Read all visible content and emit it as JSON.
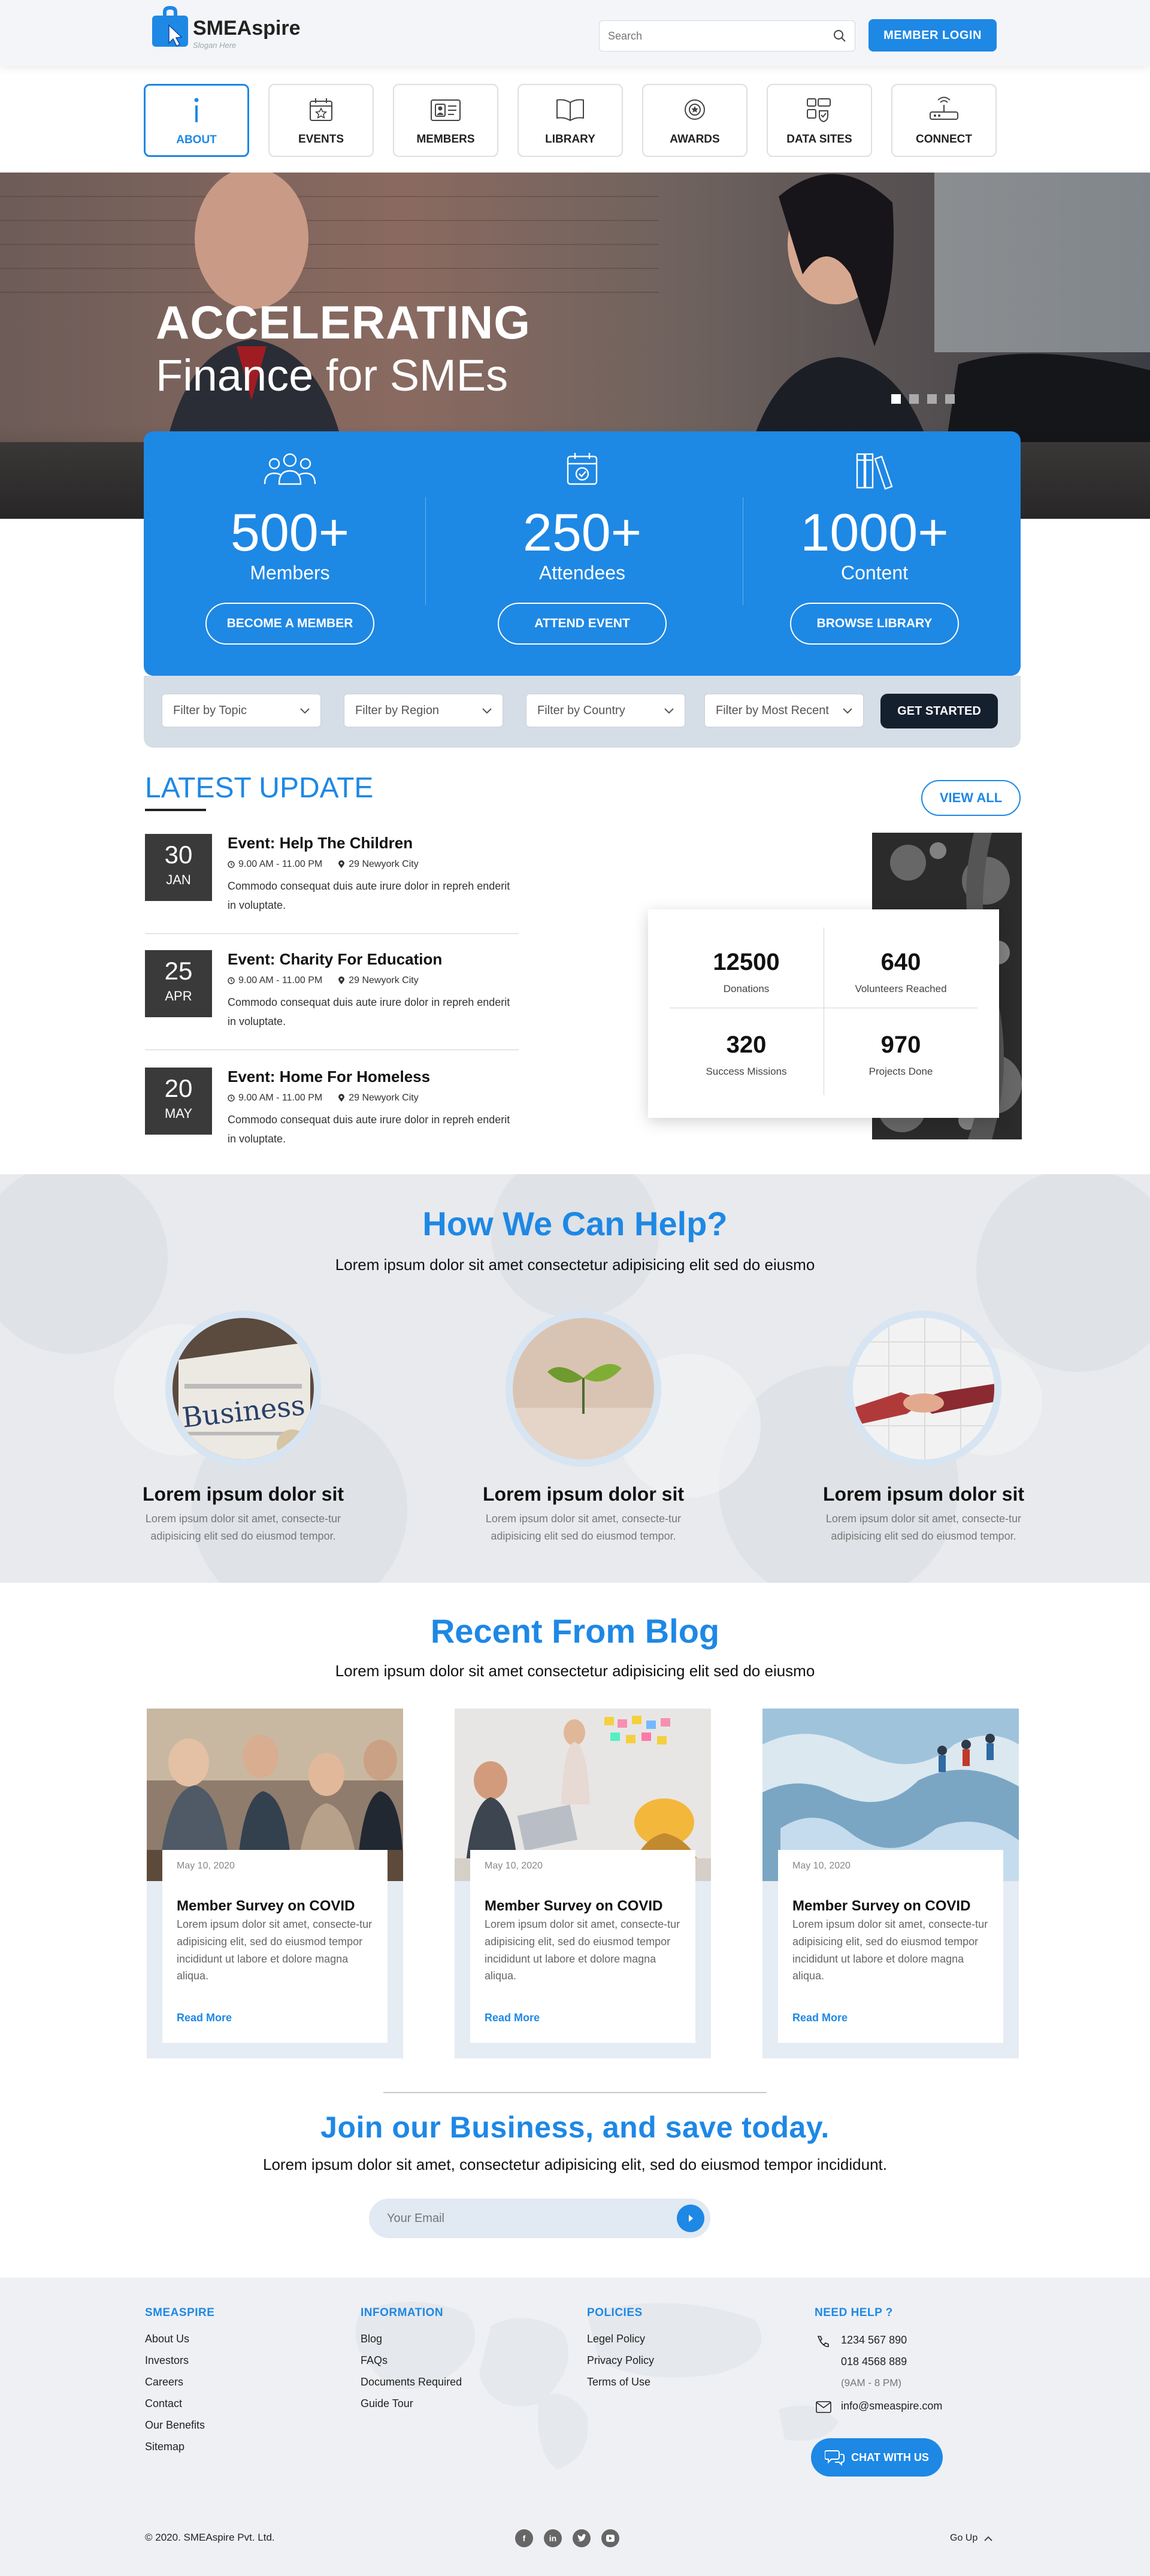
{
  "header": {
    "brand": "SMEAspire",
    "tagline": "Slogan Here",
    "search_placeholder": "Search",
    "login_label": "MEMBER LOGIN"
  },
  "nav": [
    {
      "label": "ABOUT",
      "icon": "info-icon",
      "active": true
    },
    {
      "label": "EVENTS",
      "icon": "calendar-star-icon"
    },
    {
      "label": "MEMBERS",
      "icon": "id-card-icon"
    },
    {
      "label": "LIBRARY",
      "icon": "book-icon"
    },
    {
      "label": "AWARDS",
      "icon": "medal-icon"
    },
    {
      "label": "DATA SITES",
      "icon": "data-sites-icon"
    },
    {
      "label": "CONNECT",
      "icon": "router-icon"
    }
  ],
  "hero": {
    "title": "ACCELERATING",
    "subtitle": "Finance for SMEs",
    "slides": 4,
    "active_slide": 1
  },
  "stats": [
    {
      "value": "500+",
      "label": "Members",
      "button": "BECOME A MEMBER",
      "icon": "people-icon"
    },
    {
      "value": "250+",
      "label": "Attendees",
      "button": "ATTEND EVENT",
      "icon": "calendar-check-icon"
    },
    {
      "value": "1000+",
      "label": "Content",
      "button": "BROWSE LIBRARY",
      "icon": "books-icon"
    }
  ],
  "filters": {
    "topic": "Filter by Topic",
    "region": "Filter by Region",
    "country": "Filter by Country",
    "recent": "Filter by Most Recent",
    "cta": "GET STARTED"
  },
  "latest": {
    "title": "LATEST UPDATE",
    "view_all": "VIEW ALL",
    "events": [
      {
        "day": "30",
        "month": "JAN",
        "title": "Event: Help The Children",
        "time": "9.00 AM - 11.00 PM",
        "place": "29 Newyork City",
        "desc": "Commodo consequat duis aute irure dolor in repreh enderit in voluptate."
      },
      {
        "day": "25",
        "month": "APR",
        "title": "Event: Charity For Education",
        "time": "9.00 AM - 11.00 PM",
        "place": "29 Newyork City",
        "desc": "Commodo consequat duis aute irure dolor in repreh enderit in voluptate."
      },
      {
        "day": "20",
        "month": "MAY",
        "title": "Event: Home For Homeless",
        "time": "9.00 AM - 11.00 PM",
        "place": "29 Newyork City",
        "desc": "Commodo consequat duis aute irure dolor in repreh enderit in voluptate."
      }
    ],
    "counters": [
      {
        "value": "12500",
        "label": "Donations"
      },
      {
        "value": "640",
        "label": "Volunteers Reached"
      },
      {
        "value": "320",
        "label": "Success Missions"
      },
      {
        "value": "970",
        "label": "Projects Done"
      }
    ]
  },
  "help": {
    "title": "How We Can Help?",
    "subtitle": "Lorem ipsum dolor sit amet consectetur adipisicing elit sed do eiusmo",
    "items": [
      {
        "title": "Lorem ipsum dolor sit",
        "desc": "Lorem ipsum dolor sit amet, consecte-tur adipisicing elit sed do eiusmod tempor.",
        "image": "newspaper-business"
      },
      {
        "title": "Lorem ipsum dolor sit",
        "desc": "Lorem ipsum dolor sit amet, consecte-tur adipisicing elit sed do eiusmod tempor.",
        "image": "seedling-sprout"
      },
      {
        "title": "Lorem ipsum dolor sit",
        "desc": "Lorem ipsum dolor sit amet, consecte-tur adipisicing elit sed do eiusmod tempor.",
        "image": "handshake"
      }
    ],
    "business_word": "Business"
  },
  "blog": {
    "title": "Recent From Blog",
    "subtitle": "Lorem ipsum dolor sit amet consectetur adipisicing elit sed do eiusmo",
    "posts": [
      {
        "date": "May 10, 2020",
        "title": "Member Survey on  COVID",
        "excerpt": "Lorem ipsum dolor sit amet, consecte-tur adipisicing elit, sed do eiusmod tempor incididunt ut labore et dolore magna aliqua.",
        "more": "Read More"
      },
      {
        "date": "May 10, 2020",
        "title": "Member Survey on  COVID",
        "excerpt": "Lorem ipsum dolor sit amet, consecte-tur adipisicing elit, sed do eiusmod tempor incididunt ut labore et dolore magna aliqua.",
        "more": "Read More"
      },
      {
        "date": "May 10, 2020",
        "title": "Member Survey on  COVID",
        "excerpt": "Lorem ipsum dolor sit amet, consecte-tur adipisicing elit, sed do eiusmod tempor incididunt ut labore et dolore magna aliqua.",
        "more": "Read More"
      }
    ]
  },
  "join": {
    "title": "Join our Business, and save today.",
    "subtitle": "Lorem ipsum dolor sit amet, consectetur adipisicing elit, sed do eiusmod tempor incididunt.",
    "placeholder": "Your Email"
  },
  "footer": {
    "col1": {
      "head": "SMEASPIRE",
      "items": [
        "About Us",
        "Investors",
        "Careers",
        "Contact",
        "Our Benefits",
        "Sitemap"
      ]
    },
    "col2": {
      "head": "INFORMATION",
      "items": [
        "Blog",
        "FAQs",
        "Documents Required",
        "Guide Tour"
      ]
    },
    "col3": {
      "head": "POLICIES",
      "items": [
        "Legel Policy",
        "Privacy Policy",
        "Terms of Use"
      ]
    },
    "col4": {
      "head": "NEED HELP ?",
      "phone1": "1234 567 890",
      "phone2": "018 4568 889",
      "hours": "(9AM - 8 PM)",
      "email": "info@smeaspire.com",
      "chat": "CHAT WITH US"
    },
    "copyright": "© 2020. SMEAspire Pvt. Ltd.",
    "go_up": "Go Up",
    "socials": [
      "facebook-icon",
      "linkedin-icon",
      "twitter-icon",
      "youtube-icon"
    ]
  },
  "colors": {
    "accent": "#1e88e5",
    "dark": "#14202e",
    "date_box": "#3a3a3a"
  }
}
